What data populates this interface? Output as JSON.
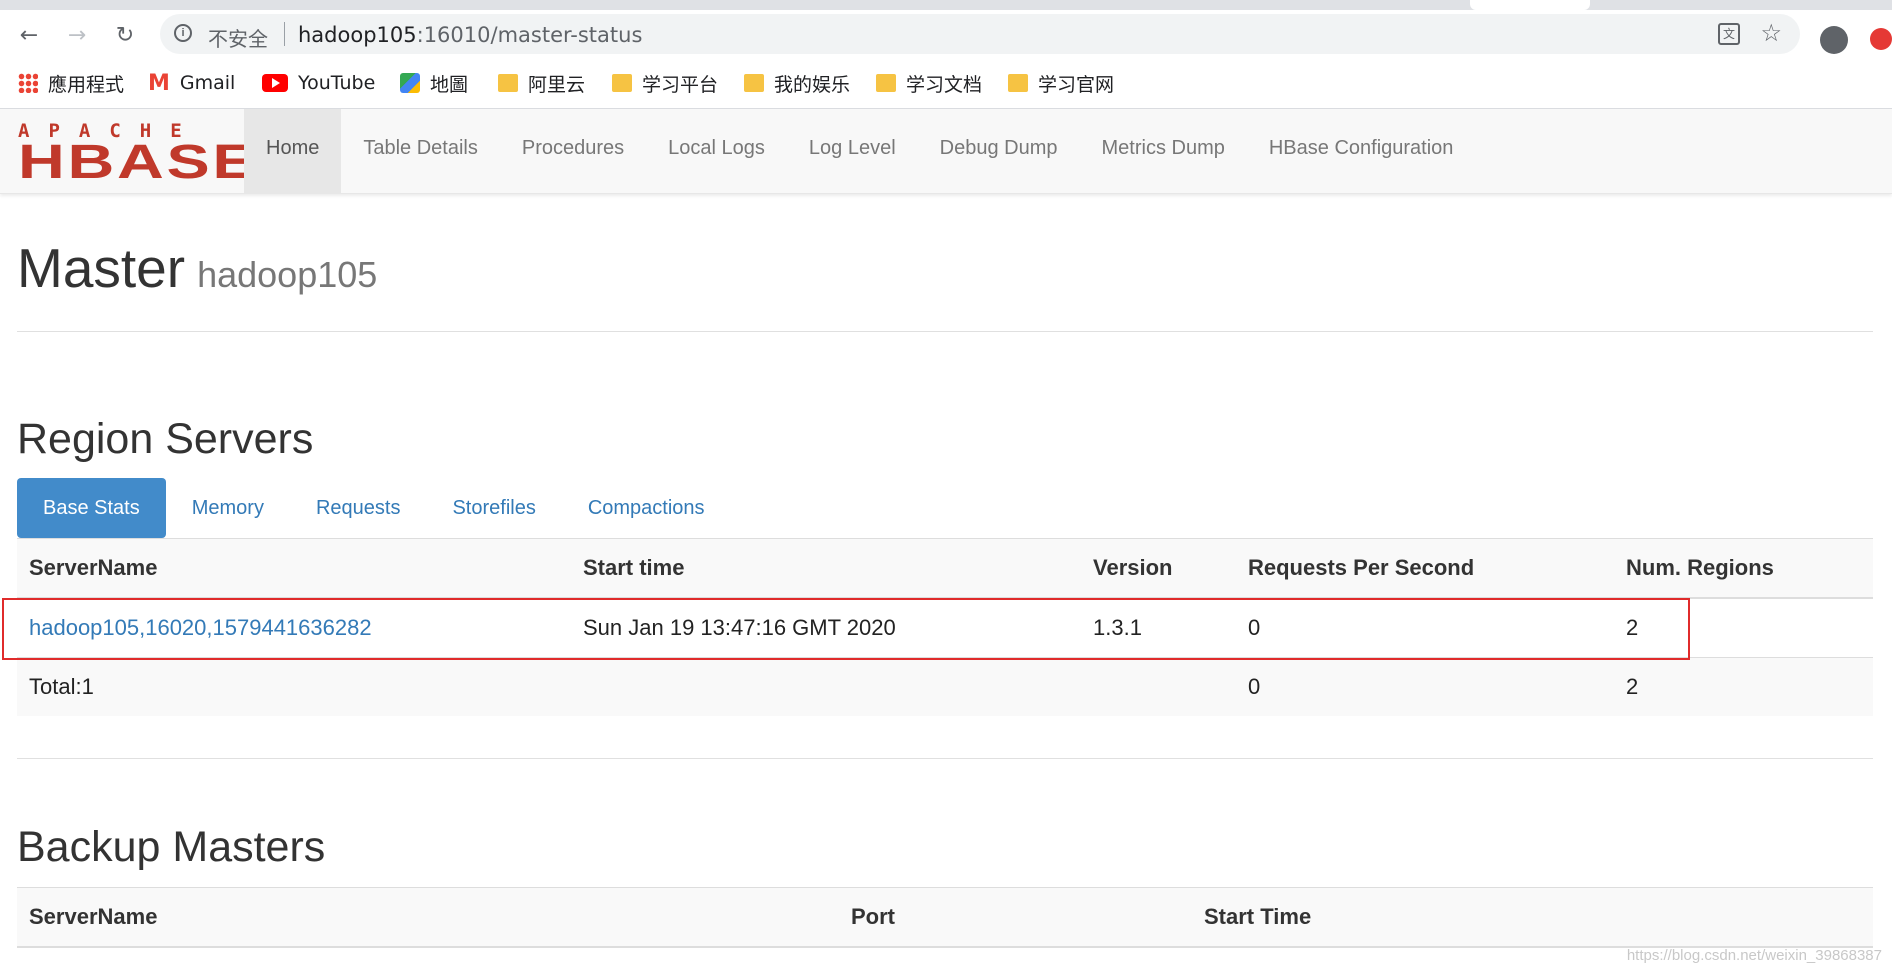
{
  "browser": {
    "insecure_label": "不安全",
    "url_host": "hadoop105",
    "url_path": ":16010/master-status",
    "bookmarks": [
      {
        "label": "應用程式",
        "icon": "apps-grid-icon"
      },
      {
        "label": "Gmail",
        "icon": "gmail-icon"
      },
      {
        "label": "YouTube",
        "icon": "youtube-icon"
      },
      {
        "label": "地圖",
        "icon": "maps-icon"
      },
      {
        "label": "阿里云",
        "icon": "folder-icon"
      },
      {
        "label": "学习平台",
        "icon": "folder-icon"
      },
      {
        "label": "我的娱乐",
        "icon": "folder-icon"
      },
      {
        "label": "学习文档",
        "icon": "folder-icon"
      },
      {
        "label": "学习官网",
        "icon": "folder-icon"
      }
    ]
  },
  "logo": {
    "top": "APACHE",
    "main": "HBASE"
  },
  "nav": {
    "items": [
      "Home",
      "Table Details",
      "Procedures",
      "Local Logs",
      "Log Level",
      "Debug Dump",
      "Metrics Dump",
      "HBase Configuration"
    ],
    "active": "Home"
  },
  "master": {
    "title": "Master",
    "host": "hadoop105"
  },
  "region_servers": {
    "heading": "Region Servers",
    "tabs": [
      "Base Stats",
      "Memory",
      "Requests",
      "Storefiles",
      "Compactions"
    ],
    "active_tab": "Base Stats",
    "columns": [
      "ServerName",
      "Start time",
      "Version",
      "Requests Per Second",
      "Num. Regions"
    ],
    "rows": [
      {
        "server": "hadoop105,16020,1579441636282",
        "start_time": "Sun Jan 19 13:47:16 GMT 2020",
        "version": "1.3.1",
        "rps": "0",
        "regions": "2"
      }
    ],
    "total": {
      "label": "Total:1",
      "rps": "0",
      "regions": "2"
    }
  },
  "backup_masters": {
    "heading": "Backup Masters",
    "columns": [
      "ServerName",
      "Port",
      "Start Time"
    ]
  },
  "watermark": "https://blog.csdn.net/weixin_39868387",
  "colors": {
    "link": "#337ab7",
    "active_tab": "#428bca",
    "highlight": "#e02b2b",
    "logo": "#c0392b"
  }
}
